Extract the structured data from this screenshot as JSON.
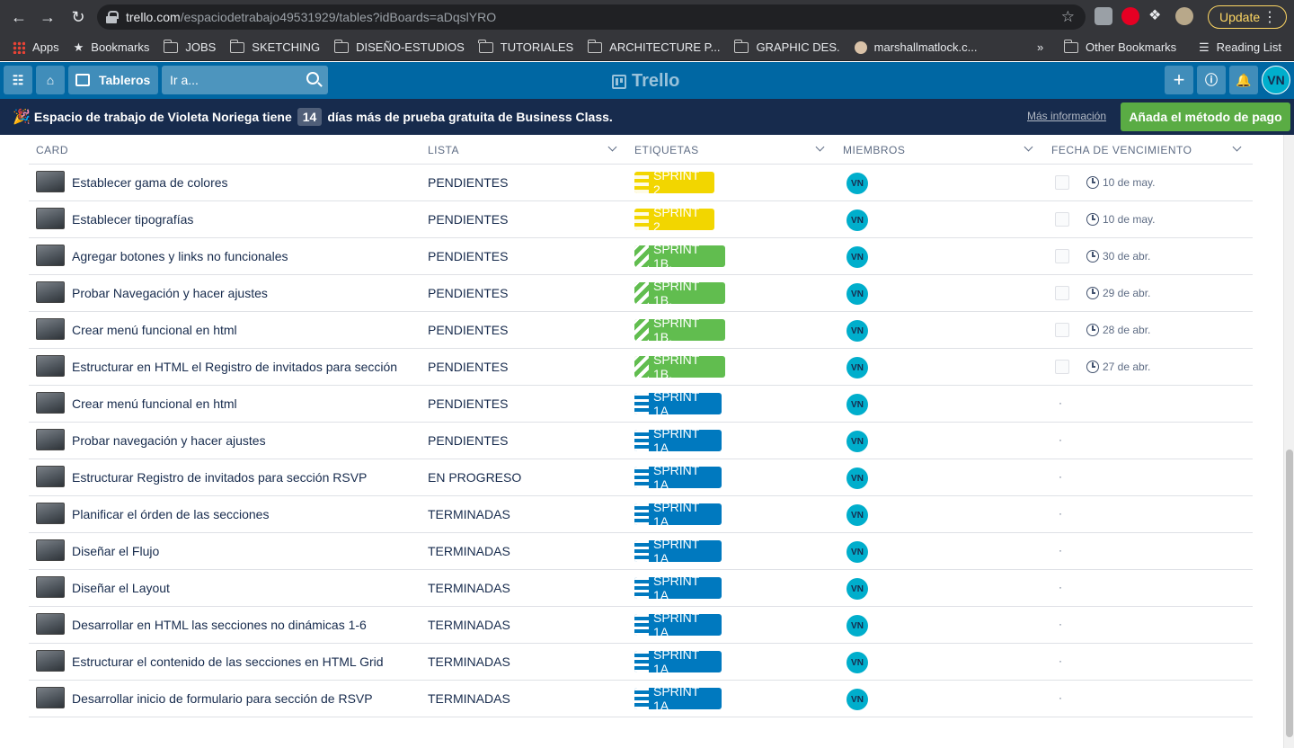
{
  "browser": {
    "url_host": "trello.com",
    "url_path": "/espaciodetrabajo49531929/tables?idBoards=aDqslYRO",
    "update_label": "Update",
    "bookmarks": [
      "Apps",
      "Bookmarks",
      "JOBS",
      "SKETCHING",
      "DISEÑO-ESTUDIOS",
      "TUTORIALES",
      "ARCHITECTURE P...",
      "GRAPHIC DES.",
      "marshallmatlock.c...",
      "»",
      "Other Bookmarks",
      "Reading List"
    ]
  },
  "header": {
    "boards_label": "Tableros",
    "search_placeholder": "Ir a...",
    "logo_text": "Trello",
    "user_initials": "VN"
  },
  "banner": {
    "text_before": "Espacio de trabajo de Violeta Noriega tiene",
    "days": "14",
    "text_after": "días más de prueba gratuita de Business Class.",
    "more_info": "Más información",
    "add_payment": "Añada el método de pago"
  },
  "table": {
    "headers": [
      "CARD",
      "LISTA",
      "ETIQUETAS",
      "MIEMBROS",
      "FECHA DE VENCIMIENTO"
    ],
    "rows": [
      {
        "card": "Establecer gama de colores",
        "list": "PENDIENTES",
        "label": "SPRINT 2",
        "label_color": "yellow",
        "member": "VN",
        "due": "10 de may."
      },
      {
        "card": "Establecer tipografías",
        "list": "PENDIENTES",
        "label": "SPRINT 2",
        "label_color": "yellow",
        "member": "VN",
        "due": "10 de may."
      },
      {
        "card": "Agregar botones y links no funcionales",
        "list": "PENDIENTES",
        "label": "SPRINT 1B.",
        "label_color": "green",
        "member": "VN",
        "due": "30 de abr."
      },
      {
        "card": "Probar Navegación y hacer ajustes",
        "list": "PENDIENTES",
        "label": "SPRINT 1B.",
        "label_color": "green",
        "member": "VN",
        "due": "29 de abr."
      },
      {
        "card": "Crear menú funcional en html",
        "list": "PENDIENTES",
        "label": "SPRINT 1B.",
        "label_color": "green",
        "member": "VN",
        "due": "28 de abr."
      },
      {
        "card": "Estructurar en HTML el Registro de invitados para sección",
        "list": "PENDIENTES",
        "label": "SPRINT 1B.",
        "label_color": "green",
        "member": "VN",
        "due": "27 de abr."
      },
      {
        "card": "Crear menú funcional en html",
        "list": "PENDIENTES",
        "label": "SPRINT 1A",
        "label_color": "blue",
        "member": "VN",
        "due": "·"
      },
      {
        "card": "Probar navegación y hacer ajustes",
        "list": "PENDIENTES",
        "label": "SPRINT 1A",
        "label_color": "blue",
        "member": "VN",
        "due": "·"
      },
      {
        "card": "Estructurar Registro de invitados para sección RSVP",
        "list": "EN PROGRESO",
        "label": "SPRINT 1A",
        "label_color": "blue",
        "member": "VN",
        "due": "·"
      },
      {
        "card": "Planificar el órden de las secciones",
        "list": "TERMINADAS",
        "label": "SPRINT 1A",
        "label_color": "blue",
        "member": "VN",
        "due": "·"
      },
      {
        "card": "Diseñar el Flujo",
        "list": "TERMINADAS",
        "label": "SPRINT 1A",
        "label_color": "blue",
        "member": "VN",
        "due": "·"
      },
      {
        "card": "Diseñar el Layout",
        "list": "TERMINADAS",
        "label": "SPRINT 1A",
        "label_color": "blue",
        "member": "VN",
        "due": "·"
      },
      {
        "card": "Desarrollar en HTML las secciones no dinámicas 1-6",
        "list": "TERMINADAS",
        "label": "SPRINT 1A",
        "label_color": "blue",
        "member": "VN",
        "due": "·"
      },
      {
        "card": "Estructurar el contenido de las secciones en HTML Grid",
        "list": "TERMINADAS",
        "label": "SPRINT 1A",
        "label_color": "blue",
        "member": "VN",
        "due": "·"
      },
      {
        "card": "Desarrollar inicio de formulario para sección de RSVP",
        "list": "TERMINADAS",
        "label": "SPRINT 1A",
        "label_color": "blue",
        "member": "VN",
        "due": "·"
      }
    ]
  },
  "colors": {
    "header_blue": "#0067a3",
    "banner_navy": "#172b4d",
    "label_yellow": "#f2d600",
    "label_green": "#61bd4f",
    "label_blue": "#0079bf",
    "member_teal": "#00aecc",
    "cta_green": "#5aac44"
  }
}
